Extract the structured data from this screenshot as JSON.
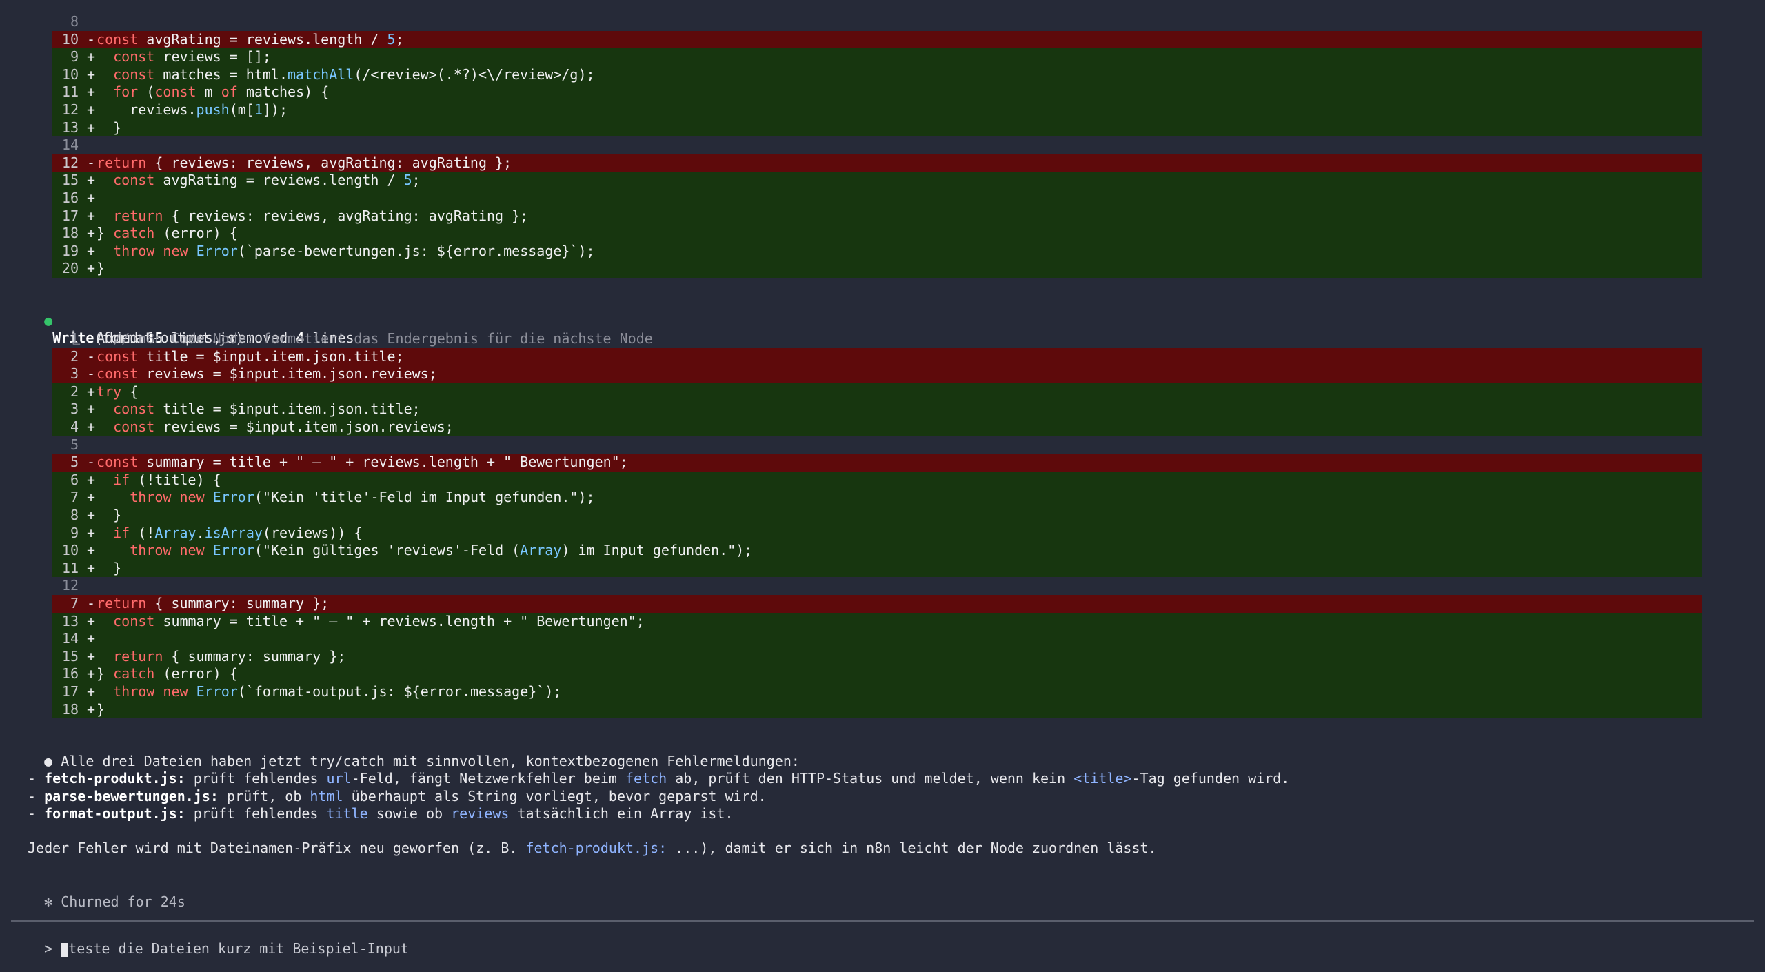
{
  "colors": {
    "background": "#262a38",
    "added_bg": "#17360f",
    "removed_bg": "#5e0a0b",
    "bullet_green": "#35c46a"
  },
  "diff1": [
    {
      "type": "ctx",
      "num": "8",
      "mark": "",
      "code": ""
    },
    {
      "type": "del",
      "num": "10",
      "mark": "-",
      "code": "const avgRating = reviews.length / 5;"
    },
    {
      "type": "add",
      "num": "9",
      "mark": "+",
      "code": "  const reviews = [];"
    },
    {
      "type": "add",
      "num": "10",
      "mark": "+",
      "code": "  const matches = html.matchAll(/<review>(.*?)<\\/review>/g);"
    },
    {
      "type": "add",
      "num": "11",
      "mark": "+",
      "code": "  for (const m of matches) {"
    },
    {
      "type": "add",
      "num": "12",
      "mark": "+",
      "code": "    reviews.push(m[1]);"
    },
    {
      "type": "add",
      "num": "13",
      "mark": "+",
      "code": "  }"
    },
    {
      "type": "ctx",
      "num": "14",
      "mark": "",
      "code": ""
    },
    {
      "type": "del",
      "num": "12",
      "mark": "-",
      "code": "return { reviews: reviews, avgRating: avgRating };"
    },
    {
      "type": "add",
      "num": "15",
      "mark": "+",
      "code": "  const avgRating = reviews.length / 5;"
    },
    {
      "type": "add",
      "num": "16",
      "mark": "+",
      "code": ""
    },
    {
      "type": "add",
      "num": "17",
      "mark": "+",
      "code": "  return { reviews: reviews, avgRating: avgRating };"
    },
    {
      "type": "add",
      "num": "18",
      "mark": "+",
      "code": "} catch (error) {"
    },
    {
      "type": "add",
      "num": "19",
      "mark": "+",
      "code": "  throw new Error(`parse-bewertungen.js: ${error.message}`);"
    },
    {
      "type": "add",
      "num": "20",
      "mark": "+",
      "code": "}"
    }
  ],
  "write_tool": {
    "bullet": "●",
    "name": "Write",
    "arg": "(format-output.js)",
    "summary_prefix": "Added ",
    "added": "15",
    "summary_mid": " lines, removed ",
    "removed": "4",
    "summary_suffix": " lines"
  },
  "diff2": [
    {
      "type": "ctx",
      "num": "1",
      "mark": "",
      "code": "  // n8n Code Node: formatiert das Endergebnis für die nächste Node"
    },
    {
      "type": "del",
      "num": "2",
      "mark": "-",
      "code": "const title = $input.item.json.title;"
    },
    {
      "type": "del",
      "num": "3",
      "mark": "-",
      "code": "const reviews = $input.item.json.reviews;"
    },
    {
      "type": "add",
      "num": "2",
      "mark": "+",
      "code": "try {"
    },
    {
      "type": "add",
      "num": "3",
      "mark": "+",
      "code": "  const title = $input.item.json.title;"
    },
    {
      "type": "add",
      "num": "4",
      "mark": "+",
      "code": "  const reviews = $input.item.json.reviews;"
    },
    {
      "type": "ctx",
      "num": "5",
      "mark": "",
      "code": ""
    },
    {
      "type": "del",
      "num": "5",
      "mark": "-",
      "code": "const summary = title + \" – \" + reviews.length + \" Bewertungen\";"
    },
    {
      "type": "add",
      "num": "6",
      "mark": "+",
      "code": "  if (!title) {"
    },
    {
      "type": "add",
      "num": "7",
      "mark": "+",
      "code": "    throw new Error(\"Kein 'title'-Feld im Input gefunden.\");"
    },
    {
      "type": "add",
      "num": "8",
      "mark": "+",
      "code": "  }"
    },
    {
      "type": "add",
      "num": "9",
      "mark": "+",
      "code": "  if (!Array.isArray(reviews)) {"
    },
    {
      "type": "add",
      "num": "10",
      "mark": "+",
      "code": "    throw new Error(\"Kein gültiges 'reviews'-Feld (Array) im Input gefunden.\");"
    },
    {
      "type": "add",
      "num": "11",
      "mark": "+",
      "code": "  }"
    },
    {
      "type": "ctx",
      "num": "12",
      "mark": "",
      "code": ""
    },
    {
      "type": "del",
      "num": "7",
      "mark": "-",
      "code": "return { summary: summary };"
    },
    {
      "type": "add",
      "num": "13",
      "mark": "+",
      "code": "  const summary = title + \" – \" + reviews.length + \" Bewertungen\";"
    },
    {
      "type": "add",
      "num": "14",
      "mark": "+",
      "code": ""
    },
    {
      "type": "add",
      "num": "15",
      "mark": "+",
      "code": "  return { summary: summary };"
    },
    {
      "type": "add",
      "num": "16",
      "mark": "+",
      "code": "} catch (error) {"
    },
    {
      "type": "add",
      "num": "17",
      "mark": "+",
      "code": "  throw new Error(`format-output.js: ${error.message}`);"
    },
    {
      "type": "add",
      "num": "18",
      "mark": "+",
      "code": "}"
    }
  ],
  "message": {
    "bullet": "●",
    "intro": "Alle drei Dateien haben jetzt try/catch mit sinnvollen, kontextbezogenen Fehlermeldungen:",
    "items": [
      {
        "file": "fetch-produkt.js:",
        "parts": [
          {
            "t": " prüft fehlendes ",
            "c": ""
          },
          {
            "t": "url",
            "c": "link"
          },
          {
            "t": "-Feld, fängt Netzwerkfehler beim ",
            "c": ""
          },
          {
            "t": "fetch",
            "c": "link"
          },
          {
            "t": " ab, prüft den HTTP-Status und meldet, wenn kein ",
            "c": ""
          },
          {
            "t": "<title>",
            "c": "link"
          },
          {
            "t": "-Tag gefunden wird.",
            "c": ""
          }
        ]
      },
      {
        "file": "parse-bewertungen.js:",
        "parts": [
          {
            "t": " prüft, ob ",
            "c": ""
          },
          {
            "t": "html",
            "c": "link"
          },
          {
            "t": " überhaupt als String vorliegt, bevor geparst wird.",
            "c": ""
          }
        ]
      },
      {
        "file": "format-output.js:",
        "parts": [
          {
            "t": " prüft fehlendes ",
            "c": ""
          },
          {
            "t": "title",
            "c": "link"
          },
          {
            "t": " sowie ob ",
            "c": ""
          },
          {
            "t": "reviews",
            "c": "link"
          },
          {
            "t": " tatsächlich ein Array ist.",
            "c": ""
          }
        ]
      }
    ],
    "closing_parts": [
      {
        "t": "Jeder Fehler wird mit Dateinamen-Präfix neu geworfen (z. B. ",
        "c": ""
      },
      {
        "t": "fetch-produkt.js:",
        "c": "link"
      },
      {
        "t": " ...), damit er sich in n8n leicht der Node zuordnen lässt.",
        "c": ""
      }
    ]
  },
  "status": {
    "star": "✻",
    "text": "Churned for 24s"
  },
  "prompt": {
    "symbol": ">",
    "input_text": "teste die Dateien kurz mit Beispiel-Input"
  }
}
